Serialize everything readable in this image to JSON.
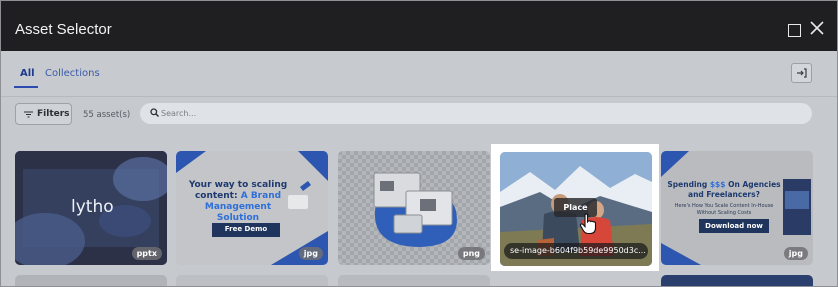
{
  "window": {
    "title": "Asset Selector",
    "maximize_icon": "maximize-icon",
    "close_icon": "close-icon"
  },
  "tabs": [
    {
      "label": "All",
      "active": true
    },
    {
      "label": "Collections",
      "active": false
    }
  ],
  "toolbar": {
    "exit_icon": "sign-in-icon"
  },
  "filterbar": {
    "filters_label": "Filters",
    "filters_icon": "filter-lines-icon",
    "asset_count": "55 asset(s)",
    "search_placeholder": "Search...",
    "search_icon": "search-icon"
  },
  "assets": [
    {
      "kind": "presentation",
      "badge": "pptx",
      "text": "lytho"
    },
    {
      "kind": "banner",
      "badge": "jpg",
      "headline_1": "Your way to scaling",
      "headline_2": "content:",
      "headline_accent": "A Brand",
      "headline_3": "Management Solution",
      "cta": "Free Demo"
    },
    {
      "kind": "illustration",
      "badge": "png"
    },
    {
      "kind": "photo",
      "badge": "",
      "hover_action": "Place",
      "filename": "se-image-b604f9b59de9950d3c..."
    },
    {
      "kind": "banner",
      "badge": "jpg",
      "headline_1": "Spending",
      "headline_accent": "$$$",
      "headline_2": "On Agencies",
      "headline_3": "and Freelancers?",
      "sub_1": "Here's How You Scale Content In-House",
      "sub_2": "Without Scaling Costs",
      "cta": "Download now"
    }
  ],
  "colors": {
    "titlebar": "#1f1f21",
    "accent": "#2b4bb0",
    "banner_blue": "#1e3f73",
    "banner_accent": "#2f6fd8"
  }
}
